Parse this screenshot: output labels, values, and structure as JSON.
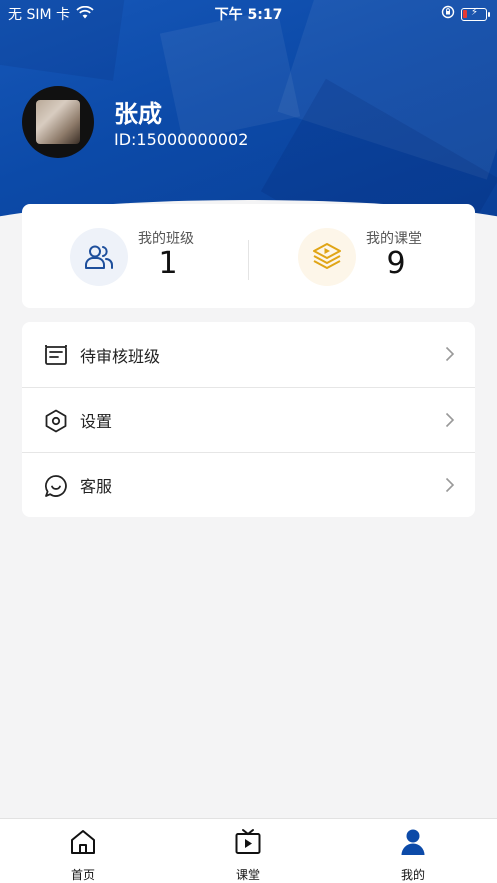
{
  "status_bar": {
    "carrier": "无 SIM 卡",
    "time": "下午 5:17"
  },
  "profile": {
    "name": "张成",
    "id_text": "ID:15000000002"
  },
  "stats": [
    {
      "label": "我的班级",
      "value": "1",
      "icon": "users-icon"
    },
    {
      "label": "我的课堂",
      "value": "9",
      "icon": "book-play-icon"
    }
  ],
  "menu": {
    "items": [
      {
        "label": "待审核班级",
        "icon": "pending-class-icon"
      },
      {
        "label": "设置",
        "icon": "settings-hexagon-icon"
      },
      {
        "label": "客服",
        "icon": "chat-bubble-icon"
      }
    ]
  },
  "tab_bar": {
    "tabs": [
      {
        "label": "首页",
        "icon": "home-icon"
      },
      {
        "label": "课堂",
        "icon": "tv-play-icon"
      },
      {
        "label": "我的",
        "icon": "person-icon"
      }
    ],
    "active_index": 2
  },
  "colors": {
    "brand_blue": "#0c4aa8",
    "stat_icon_blue": "#1e4f9c",
    "stat_icon_gold": "#e0a516",
    "tab_active": "#0c4aa8",
    "battery_low": "#e53935"
  }
}
